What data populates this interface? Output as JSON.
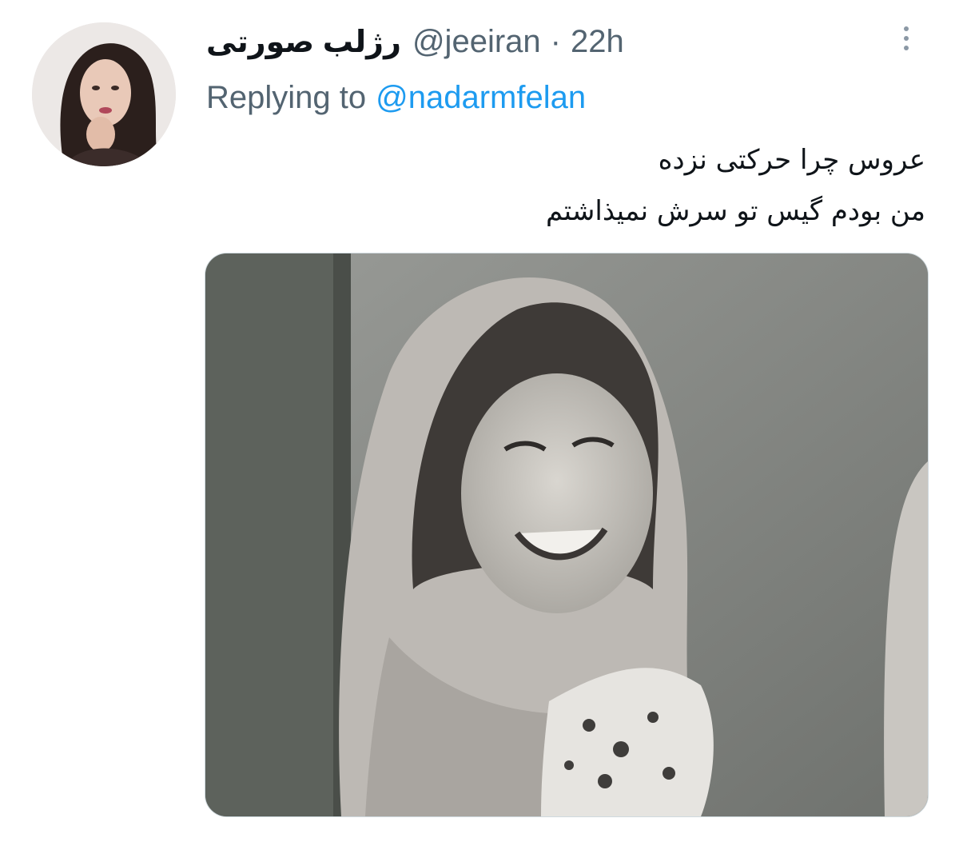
{
  "tweet": {
    "display_name": "رژلب صورتی",
    "handle": "@jeeiran",
    "separator": "·",
    "timestamp": "22h",
    "reply_prefix": "Replying to",
    "reply_target": "@nadarmfelan",
    "text_lines": [
      "عروس چرا حرکتی نزده",
      "من بودم گیس تو سرش نمیذاشتم"
    ]
  },
  "icons": {
    "more": "more-vertical-icon",
    "avatar": "profile-photo",
    "media": "attached-photo"
  },
  "colors": {
    "text": "#0f1419",
    "secondary": "#536471",
    "link": "#1d9bf0",
    "border": "#cfd9de"
  }
}
